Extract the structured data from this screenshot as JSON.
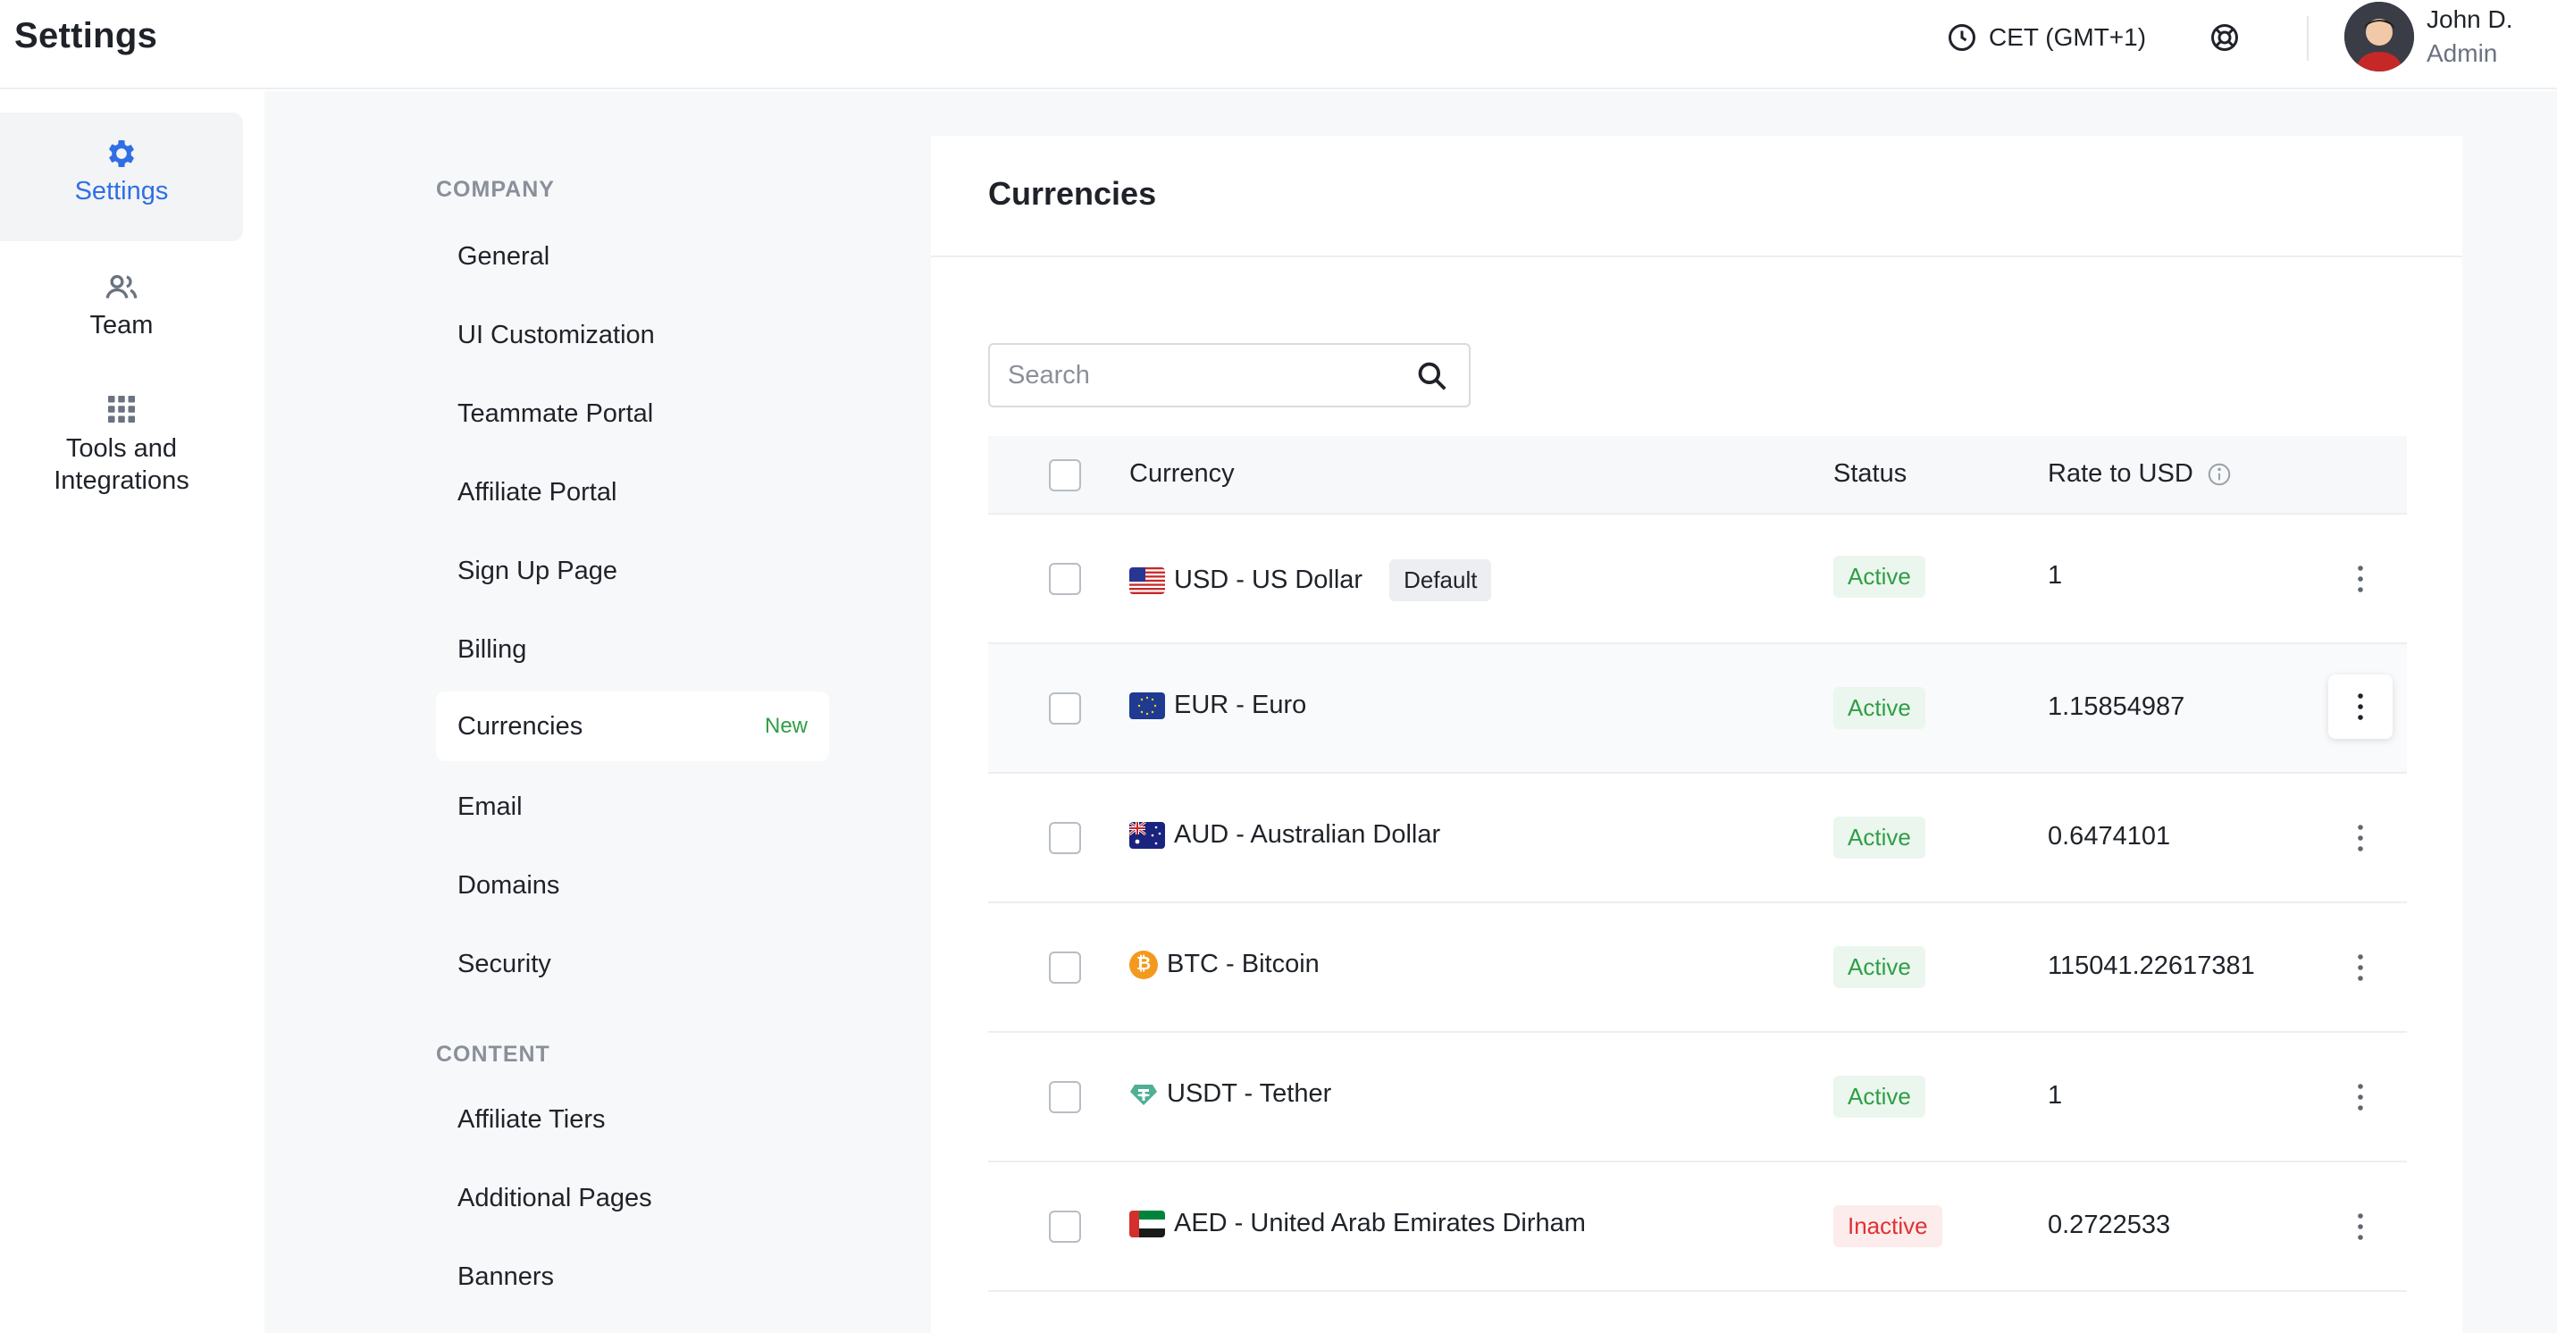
{
  "header": {
    "title": "Settings",
    "timezone": "CET (GMT+1)",
    "user_name": "John D.",
    "user_role": "Admin"
  },
  "rail": {
    "items": [
      {
        "label": "Settings",
        "icon": "gear-icon",
        "active": true
      },
      {
        "label": "Team",
        "icon": "users-icon",
        "active": false
      },
      {
        "label": "Tools and Integrations",
        "icon": "grid-icon",
        "active": false
      }
    ]
  },
  "nav": {
    "company_title": "COMPANY",
    "company_items": [
      {
        "label": "General"
      },
      {
        "label": "UI Customization"
      },
      {
        "label": "Teammate Portal"
      },
      {
        "label": "Affiliate Portal"
      },
      {
        "label": "Sign Up Page"
      },
      {
        "label": "Billing"
      },
      {
        "label": "Currencies",
        "badge": "New",
        "active": true
      },
      {
        "label": "Email"
      },
      {
        "label": "Domains"
      },
      {
        "label": "Security"
      }
    ],
    "content_title": "CONTENT",
    "content_items": [
      {
        "label": "Affiliate Tiers"
      },
      {
        "label": "Additional Pages"
      },
      {
        "label": "Banners"
      }
    ]
  },
  "main": {
    "title": "Currencies",
    "search_placeholder": "Search",
    "columns": {
      "currency": "Currency",
      "status": "Status",
      "rate": "Rate to USD"
    },
    "default_label": "Default",
    "rows": [
      {
        "code": "USD - US Dollar",
        "icon": "us-flag-icon",
        "status": "Active",
        "rate": "1",
        "default": true
      },
      {
        "code": "EUR - Euro",
        "icon": "eu-flag-icon",
        "status": "Active",
        "rate": "1.15854987"
      },
      {
        "code": "AUD - Australian Dollar",
        "icon": "au-flag-icon",
        "status": "Active",
        "rate": "0.6474101"
      },
      {
        "code": "BTC - Bitcoin",
        "icon": "bitcoin-icon",
        "status": "Active",
        "rate": "115041.22617381"
      },
      {
        "code": "USDT - Tether",
        "icon": "tether-icon",
        "status": "Active",
        "rate": "1"
      },
      {
        "code": "AED - United Arab Emirates Dirham",
        "icon": "ae-flag-icon",
        "status": "Inactive",
        "rate": "0.2722533"
      }
    ]
  },
  "colors": {
    "accent": "#2f6fe4",
    "active_text": "#2f9e44",
    "active_bg": "#ebf6ee",
    "inactive_text": "#e03131",
    "inactive_bg": "#fdecec"
  }
}
